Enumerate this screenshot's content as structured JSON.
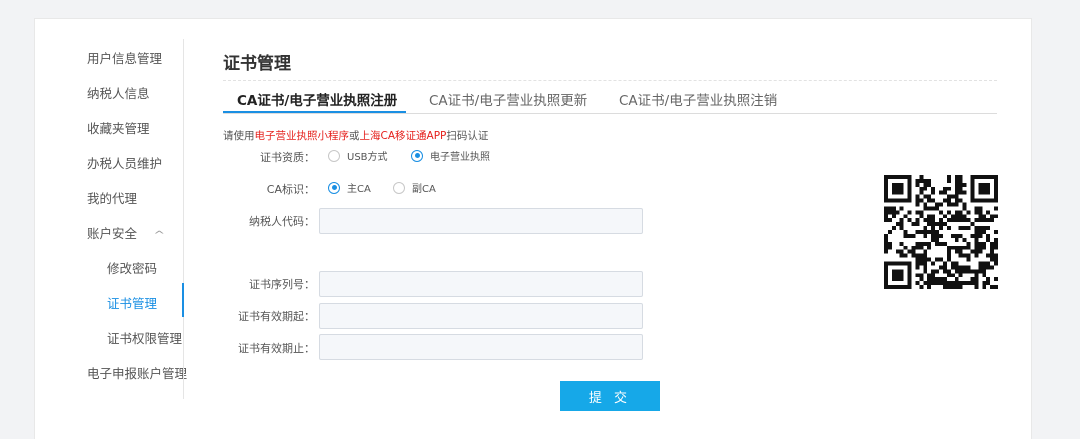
{
  "sidebar": {
    "items": [
      {
        "label": "用户信息管理"
      },
      {
        "label": "纳税人信息"
      },
      {
        "label": "收藏夹管理"
      },
      {
        "label": "办税人员维护"
      },
      {
        "label": "我的代理"
      },
      {
        "label": "账户安全",
        "expanded": true
      },
      {
        "label": "修改密码"
      },
      {
        "label": "证书管理",
        "active": true
      },
      {
        "label": "证书权限管理"
      },
      {
        "label": "电子申报账户管理"
      }
    ],
    "chevron_icon": "chevron-up-icon"
  },
  "main": {
    "title": "证书管理",
    "tabs": [
      {
        "label": "CA证书/电子营业执照注册",
        "active": true
      },
      {
        "label": "CA证书/电子营业执照更新"
      },
      {
        "label": "CA证书/电子营业执照注销"
      }
    ]
  },
  "notice": {
    "prefix": "请使用",
    "app1": "电子营业执照小程序",
    "or": "或",
    "app2": "上海CA移证通APP",
    "suffix": "扫码认证"
  },
  "form": {
    "cert_type": {
      "label": "证书资质：",
      "options": [
        "USB方式",
        "电子营业执照"
      ],
      "selected": "电子营业执照"
    },
    "ca_flag": {
      "label": "CA标识：",
      "options": [
        "主CA",
        "副CA"
      ],
      "selected": "主CA"
    },
    "taxpayer_code": {
      "label": "纳税人代码：",
      "value": ""
    },
    "cert_serial": {
      "label": "证书序列号：",
      "value": ""
    },
    "valid_from": {
      "label": "证书有效期起：",
      "value": ""
    },
    "valid_to": {
      "label": "证书有效期止：",
      "value": ""
    },
    "submit_label": "提 交"
  },
  "colors": {
    "accent": "#1a8fe3",
    "submit": "#16a8e8",
    "highlight": "#e5211d"
  }
}
